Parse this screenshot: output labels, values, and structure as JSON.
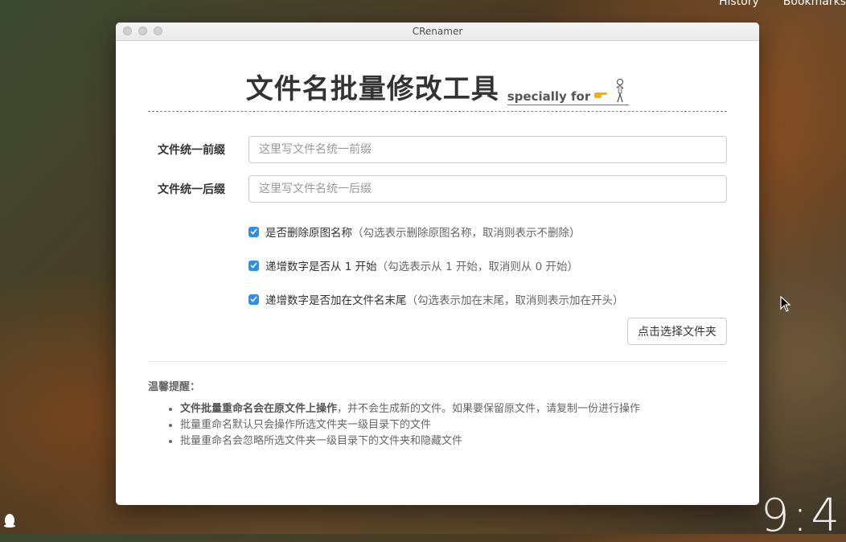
{
  "desktop": {
    "menubar": [
      "History",
      "Bookmarks"
    ],
    "clock": "9:4"
  },
  "window": {
    "title": "CRenamer"
  },
  "header": {
    "title": "文件名批量修改工具",
    "subtitle": "specially for"
  },
  "form": {
    "prefix": {
      "label": "文件统一前缀",
      "placeholder": "这里写文件名统一前缀",
      "value": ""
    },
    "suffix": {
      "label": "文件统一后缀",
      "placeholder": "这里写文件名统一后缀",
      "value": ""
    }
  },
  "options": [
    {
      "label": "是否删除原图名称",
      "hint": "（勾选表示删除原图名称，取消则表示不删除）",
      "checked": true
    },
    {
      "label": "递增数字是否从 1 开始",
      "hint": "（勾选表示从 1 开始，取消则从 0 开始）",
      "checked": true
    },
    {
      "label": "递增数字是否加在文件名末尾",
      "hint": "（勾选表示加在末尾，取消则表示加在开头）",
      "checked": true
    }
  ],
  "select_button": "点击选择文件夹",
  "tips": {
    "title": "温馨提醒：",
    "items": [
      {
        "bold": "文件批量重命名会在原文件上操作",
        "rest": "，并不会生成新的文件。如果要保留原文件，请复制一份进行操作"
      },
      {
        "bold": "",
        "rest": "批量重命名默认只会操作所选文件夹一级目录下的文件"
      },
      {
        "bold": "",
        "rest": "批量重命名会忽略所选文件夹一级目录下的文件夹和隐藏文件"
      }
    ]
  },
  "colors": {
    "checkbox": "#2b8ef0",
    "title_text": "#333333"
  }
}
